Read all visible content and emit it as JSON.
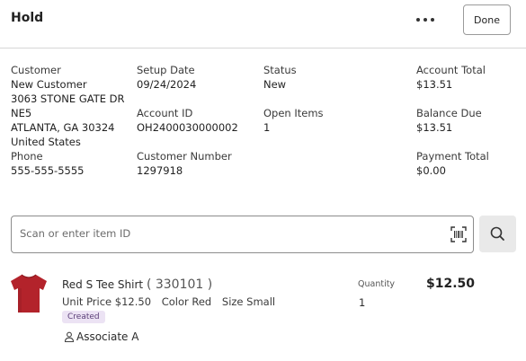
{
  "header": {
    "title": "Hold",
    "more_icon": "more-horizontal-icon",
    "done_label": "Done"
  },
  "info": {
    "customer": {
      "label": "Customer",
      "name": "New Customer",
      "address1": "3063 STONE GATE DR",
      "address2": "NE5",
      "city_state_zip": "ATLANTA, GA 30324",
      "country": "United States"
    },
    "phone": {
      "label": "Phone",
      "value": "555-555-5555"
    },
    "setup_date": {
      "label": "Setup Date",
      "value": "09/24/2024"
    },
    "account_id": {
      "label": "Account ID",
      "value": "OH2400030000002"
    },
    "customer_number": {
      "label": "Customer Number",
      "value": "1297918"
    },
    "status": {
      "label": "Status",
      "value": "New"
    },
    "open_items": {
      "label": "Open Items",
      "value": "1"
    },
    "account_total": {
      "label": "Account Total",
      "value": "$13.51"
    },
    "balance_due": {
      "label": "Balance Due",
      "value": "$13.51"
    },
    "payment_total": {
      "label": "Payment Total",
      "value": "$0.00"
    }
  },
  "search": {
    "placeholder": "Scan or enter item ID",
    "scan_icon": "barcode-scan-icon",
    "search_icon": "search-icon"
  },
  "item": {
    "name": "Red S Tee Shirt",
    "code": "( 330101 )",
    "unit_price_label": "Unit Price",
    "unit_price": "$12.50",
    "color_label": "Color",
    "color": "Red",
    "size_label": "Size",
    "size": "Small",
    "badge": "Created",
    "associate": "Associate A",
    "quantity_label": "Quantity",
    "quantity": "1",
    "price": "$12.50",
    "image_icon": "red-tshirt-image"
  },
  "colors": {
    "shirt": "#b3232b",
    "badge_bg": "#ece3f4",
    "badge_text": "#5b3f78",
    "search_button_bg": "#e9e9e9"
  }
}
